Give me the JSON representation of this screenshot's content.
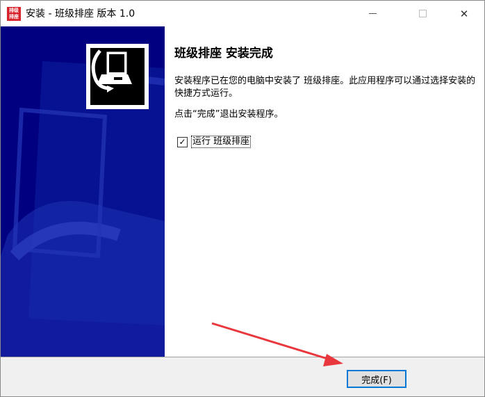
{
  "window": {
    "title": "安装 - 班级排座 版本 1.0",
    "app_icon_text_top": "排级",
    "app_icon_text_bottom": "排座",
    "minimize_label": "",
    "maximize_label": "",
    "close_label": "✕"
  },
  "content": {
    "heading": "班级排座 安装完成",
    "description": "安装程序已在您的电脑中安装了 班级排座。此应用程序可以通过选择安装的快捷方式运行。",
    "hint": "点击“完成”退出安装程序。",
    "run_checkbox": {
      "label": "运行 班级排座",
      "checked": true,
      "check_glyph": "✓"
    }
  },
  "footer": {
    "finish_label": "完成(F)"
  },
  "colors": {
    "banner": "#000080",
    "annotation_arrow": "#e8383d",
    "focus_border": "#0078d7"
  }
}
